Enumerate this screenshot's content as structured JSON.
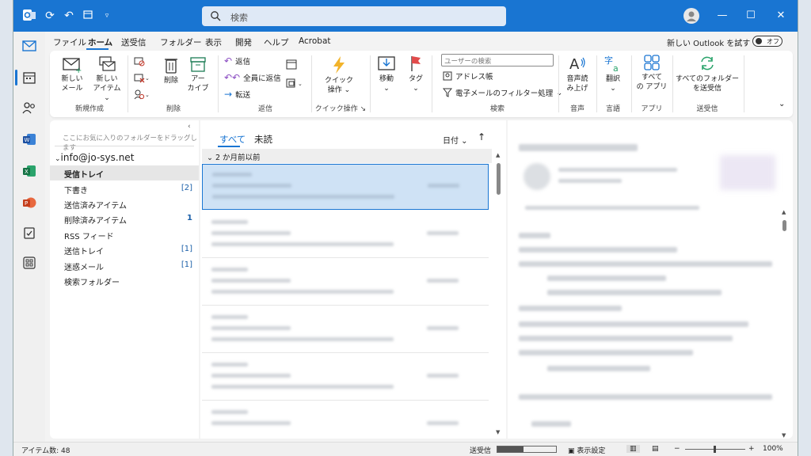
{
  "titlebar": {
    "search_placeholder": "検索",
    "icons": [
      "outlook-app-icon",
      "sync-icon",
      "undo-icon",
      "calendar-view-icon",
      "customize-icon"
    ]
  },
  "menu": {
    "tabs": [
      "ファイル",
      "ホーム",
      "送受信",
      "フォルダー",
      "表示",
      "開発",
      "ヘルプ",
      "Acrobat"
    ],
    "active": "ホーム",
    "try_new": "新しい Outlook を試す",
    "toggle_label": "オフ"
  },
  "ribbon": {
    "new_mail": [
      "新しい",
      "メール"
    ],
    "new_items": [
      "新しい",
      "アイテム ⌄"
    ],
    "group_new": "新規作成",
    "delete": "削除",
    "archive": [
      "アー",
      "カイブ"
    ],
    "group_delete": "削除",
    "reply": "返信",
    "reply_all": "全員に返信",
    "forward": "転送",
    "group_reply": "返信",
    "quick_steps": [
      "クイック",
      "操作 ⌄"
    ],
    "group_quick": "クイック操作",
    "move": "移動",
    "tags": "タグ",
    "filter_placeholder": "ユーザーの検索",
    "address_book": "アドレス帳",
    "filter_email": "電子メールのフィルター処理",
    "group_search": "検索",
    "read_aloud": [
      "音声読",
      "み上げ"
    ],
    "group_voice": "音声",
    "translate": "翻訳",
    "group_language": "言語",
    "all_apps": [
      "すべて",
      "の アプリ"
    ],
    "group_apps": "アプリ",
    "send_receive_all": [
      "すべてのフォルダー",
      "を送受信"
    ],
    "group_sendreceive": "送受信"
  },
  "folders": {
    "drag_hint": "ここにお気に入りのフォルダーをドラッグします",
    "account": "info@jo-sys.net",
    "items": [
      {
        "label": "受信トレイ",
        "count": ""
      },
      {
        "label": "下書き",
        "count": "[2]"
      },
      {
        "label": "送信済みアイテム",
        "count": ""
      },
      {
        "label": "削除済みアイテム",
        "count": "1"
      },
      {
        "label": "RSS フィード",
        "count": ""
      },
      {
        "label": "送信トレイ",
        "count": "[1]"
      },
      {
        "label": "迷惑メール",
        "count": "[1]"
      },
      {
        "label": "検索フォルダー",
        "count": ""
      }
    ]
  },
  "message_list": {
    "tab_all": "すべて",
    "tab_unread": "未読",
    "sort_label": "日付 ⌄",
    "sort_direction": "↑",
    "group_header": "2 か月前以前"
  },
  "status": {
    "item_count": "アイテム数: 48",
    "send_receive": "送受信",
    "send_receive_progress": 0.45,
    "view_settings": "表示設定",
    "zoom": "100%"
  }
}
